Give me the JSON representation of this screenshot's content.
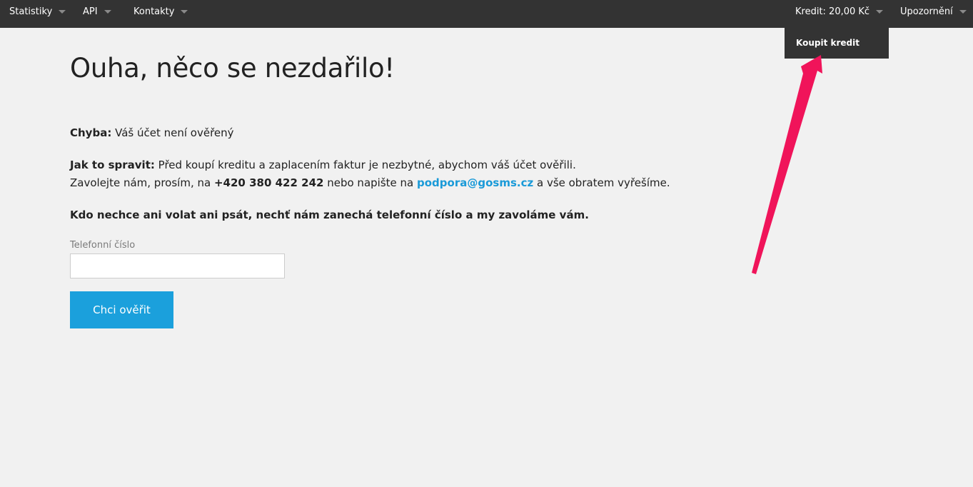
{
  "topbar": {
    "nav": [
      {
        "label": "Statistiky"
      },
      {
        "label": "API"
      },
      {
        "label": "Kontakty"
      }
    ],
    "credit": {
      "label": "Kredit: 20,00 Kč"
    },
    "notifications": {
      "label": "Upozornění"
    },
    "credit_dropdown": {
      "items": [
        {
          "label": "Koupit kredit"
        }
      ]
    }
  },
  "main": {
    "heading": "Ouha, něco se nezdařilo!",
    "error_label": "Chyba:",
    "error_text": "Váš účet není ověřený",
    "fix_label": "Jak to spravit:",
    "fix_text": "Před koupí kreditu a zaplacením faktur je nezbytné, abychom váš účet ověřili.",
    "contact_prefix": "Zavolejte nám, prosím, na",
    "phone": "+420 380 422 242",
    "contact_middle": "nebo napište na",
    "email": "podpora@gosms.cz",
    "contact_suffix": "a vše obratem vyřešíme.",
    "callback_text": "Kdo nechce ani volat ani psát, nechť nám zanechá telefonní číslo a my zavoláme vám.",
    "phone_field": {
      "label": "Telefonní číslo",
      "value": "",
      "placeholder": ""
    },
    "submit_label": "Chci ověřit"
  },
  "colors": {
    "topbar_bg": "#333333",
    "page_bg": "#f1f1f1",
    "accent": "#1ba0dc",
    "annotation_arrow": "#f0145a"
  },
  "icons": {
    "dropdown_caret": "chevron-down-icon",
    "annotation": "arrow-annotation"
  }
}
